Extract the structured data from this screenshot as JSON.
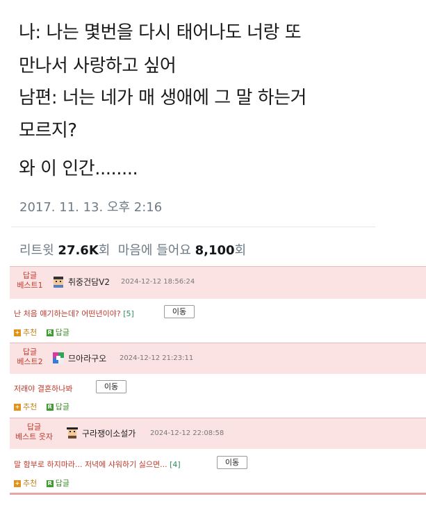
{
  "tweet": {
    "lines": [
      "나: 나는 몇번을 다시 태어나도 너랑 또",
      "만나서 사랑하고 싶어",
      "남편: 너는 네가 매 생애에 그 말 하는거",
      "모르지?",
      "와 이 인간........"
    ],
    "date": "2017. 11. 13. 오후 2:16",
    "retweet_label": "리트윗",
    "retweet_count": "27.6K",
    "retweet_unit": "회",
    "like_label": "마음에 들어요",
    "like_count": "8,100",
    "like_unit": "회"
  },
  "comments": [
    {
      "badge_top": "답글",
      "badge_bottom": "베스트1",
      "nickname": "취중건담V2",
      "time": "2024-12-12 18:56:24",
      "text": "난 처음 얘기하는데? 어떤년이야?",
      "reply_count": "[5]",
      "move_label": "이동",
      "recommend_label": "추천",
      "reply_label": "답글"
    },
    {
      "badge_top": "답글",
      "badge_bottom": "베스트2",
      "nickname": "므아라구오",
      "time": "2024-12-12 21:23:11",
      "text": "저래야 결혼하나봐",
      "reply_count": "",
      "move_label": "이동",
      "recommend_label": "추천",
      "reply_label": "답글"
    },
    {
      "badge_top": "답글",
      "badge_bottom": "베스트 웃자",
      "nickname": "구라쟁이소설가",
      "time": "2024-12-12 22:08:58",
      "text": "말 함부로 하지마라... 저녁에 샤워하기 싫으면...",
      "reply_count": "[4]",
      "move_label": "이동",
      "recommend_label": "추천",
      "reply_label": "답글"
    }
  ],
  "colors": {
    "header_bg": "#fbe3e3",
    "badge_red": "#c0392b",
    "comment_red": "#c0392b",
    "recommend_orange": "#e09319",
    "reply_green": "#3d9b2f"
  },
  "icons": {
    "recommend": "plus-square-icon",
    "reply": "r-square-icon",
    "avatar": "pixel-avatar-icon"
  }
}
